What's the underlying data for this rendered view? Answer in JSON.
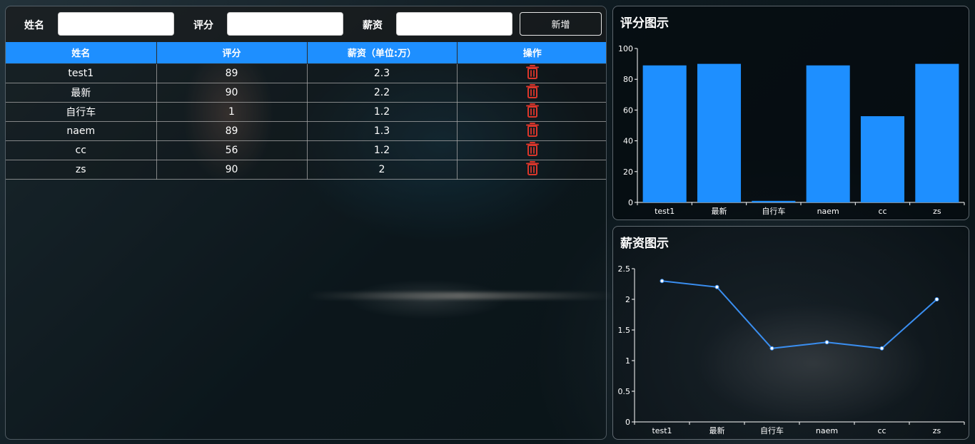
{
  "form": {
    "name_label": "姓名",
    "score_label": "评分",
    "salary_label": "薪资",
    "name_value": "",
    "score_value": "",
    "salary_value": "",
    "add_button": "新增"
  },
  "table": {
    "headers": [
      "姓名",
      "评分",
      "薪资（单位:万）",
      "操作"
    ],
    "rows": [
      {
        "name": "test1",
        "score": "89",
        "salary": "2.3"
      },
      {
        "name": "最新",
        "score": "90",
        "salary": "2.2"
      },
      {
        "name": "自行车",
        "score": "1",
        "salary": "1.2"
      },
      {
        "name": "naem",
        "score": "89",
        "salary": "1.3"
      },
      {
        "name": "cc",
        "score": "56",
        "salary": "1.2"
      },
      {
        "name": "zs",
        "score": "90",
        "salary": "2"
      }
    ],
    "delete_icon": "trash-icon",
    "delete_color": "#d9362b"
  },
  "chart_data": [
    {
      "type": "bar",
      "title": "评分图示",
      "categories": [
        "test1",
        "最新",
        "自行车",
        "naem",
        "cc",
        "zs"
      ],
      "values": [
        89,
        90,
        1,
        89,
        56,
        90
      ],
      "ylim": [
        0,
        100
      ],
      "yticks": [
        0,
        20,
        40,
        60,
        80,
        100
      ],
      "color": "#1e8fff",
      "grid": false
    },
    {
      "type": "line",
      "title": "薪资图示",
      "categories": [
        "test1",
        "最新",
        "自行车",
        "naem",
        "cc",
        "zs"
      ],
      "values": [
        2.3,
        2.2,
        1.2,
        1.3,
        1.2,
        2
      ],
      "ylim": [
        0,
        2.5
      ],
      "yticks": [
        0,
        0.5,
        1,
        1.5,
        2,
        2.5
      ],
      "yticklabels": [
        "0",
        "0.5",
        "1",
        "1.5",
        "2",
        "2.5"
      ],
      "color": "#3a8ef0",
      "grid": false
    }
  ]
}
